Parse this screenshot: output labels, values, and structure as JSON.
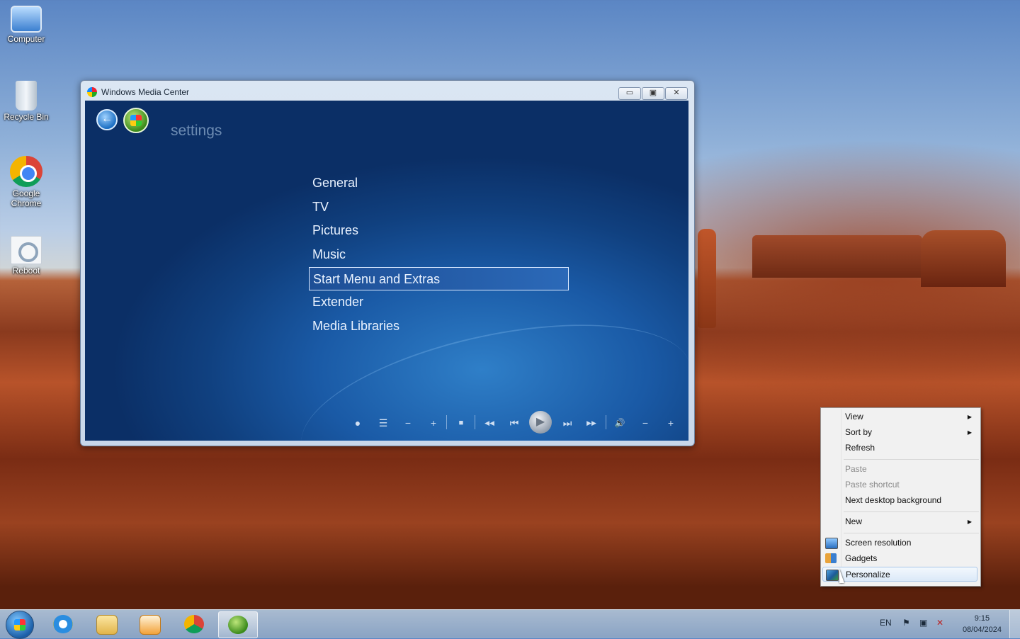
{
  "desktop": {
    "icons": [
      {
        "label": "Computer"
      },
      {
        "label": "Recycle Bin"
      },
      {
        "label": "Google Chrome"
      },
      {
        "label": "Reboot"
      }
    ]
  },
  "window": {
    "title": "Windows Media Center",
    "buttons": {
      "minimize": "▭",
      "maximize": "▣",
      "close": "✕"
    },
    "breadcrumb": "settings",
    "menu": [
      {
        "label": "General"
      },
      {
        "label": "TV"
      },
      {
        "label": "Pictures"
      },
      {
        "label": "Music"
      },
      {
        "label": "Start Menu and Extras",
        "selected": true
      },
      {
        "label": "Extender"
      },
      {
        "label": "Media Libraries"
      }
    ],
    "controls": {
      "record": "●",
      "guide": "☰",
      "channel_down": "−",
      "channel_up": "+",
      "stop": "■",
      "rewind": "◀◀",
      "prev": "⏮",
      "play": "▶",
      "next": "⏭",
      "fast_forward": "▶▶",
      "mute": "🔊",
      "volume_down": "−",
      "volume_up": "+"
    }
  },
  "context_menu": {
    "items": [
      {
        "label": "View",
        "submenu": true
      },
      {
        "label": "Sort by",
        "submenu": true
      },
      {
        "label": "Refresh"
      },
      {
        "label": "Paste",
        "disabled": true
      },
      {
        "label": "Paste shortcut",
        "disabled": true
      },
      {
        "label": "Next desktop background"
      },
      {
        "label": "New",
        "submenu": true
      },
      {
        "label": "Screen resolution",
        "icon": "monitor-icon"
      },
      {
        "label": "Gadgets",
        "icon": "gadgets-icon"
      },
      {
        "label": "Personalize",
        "icon": "personalize-icon",
        "highlighted": true
      }
    ],
    "submenu_arrow": "▶"
  },
  "taskbar": {
    "apps": [
      "start-button",
      "internet-explorer",
      "windows-explorer",
      "windows-media-player",
      "google-chrome",
      "windows-media-center"
    ],
    "language": "EN",
    "time": "9:15",
    "date": "08/04/2024"
  },
  "colors": {
    "wmc_bg": "#1a5aa6",
    "menu_selected": "#2b69b8",
    "context_highlight": "#dbe9f8"
  }
}
